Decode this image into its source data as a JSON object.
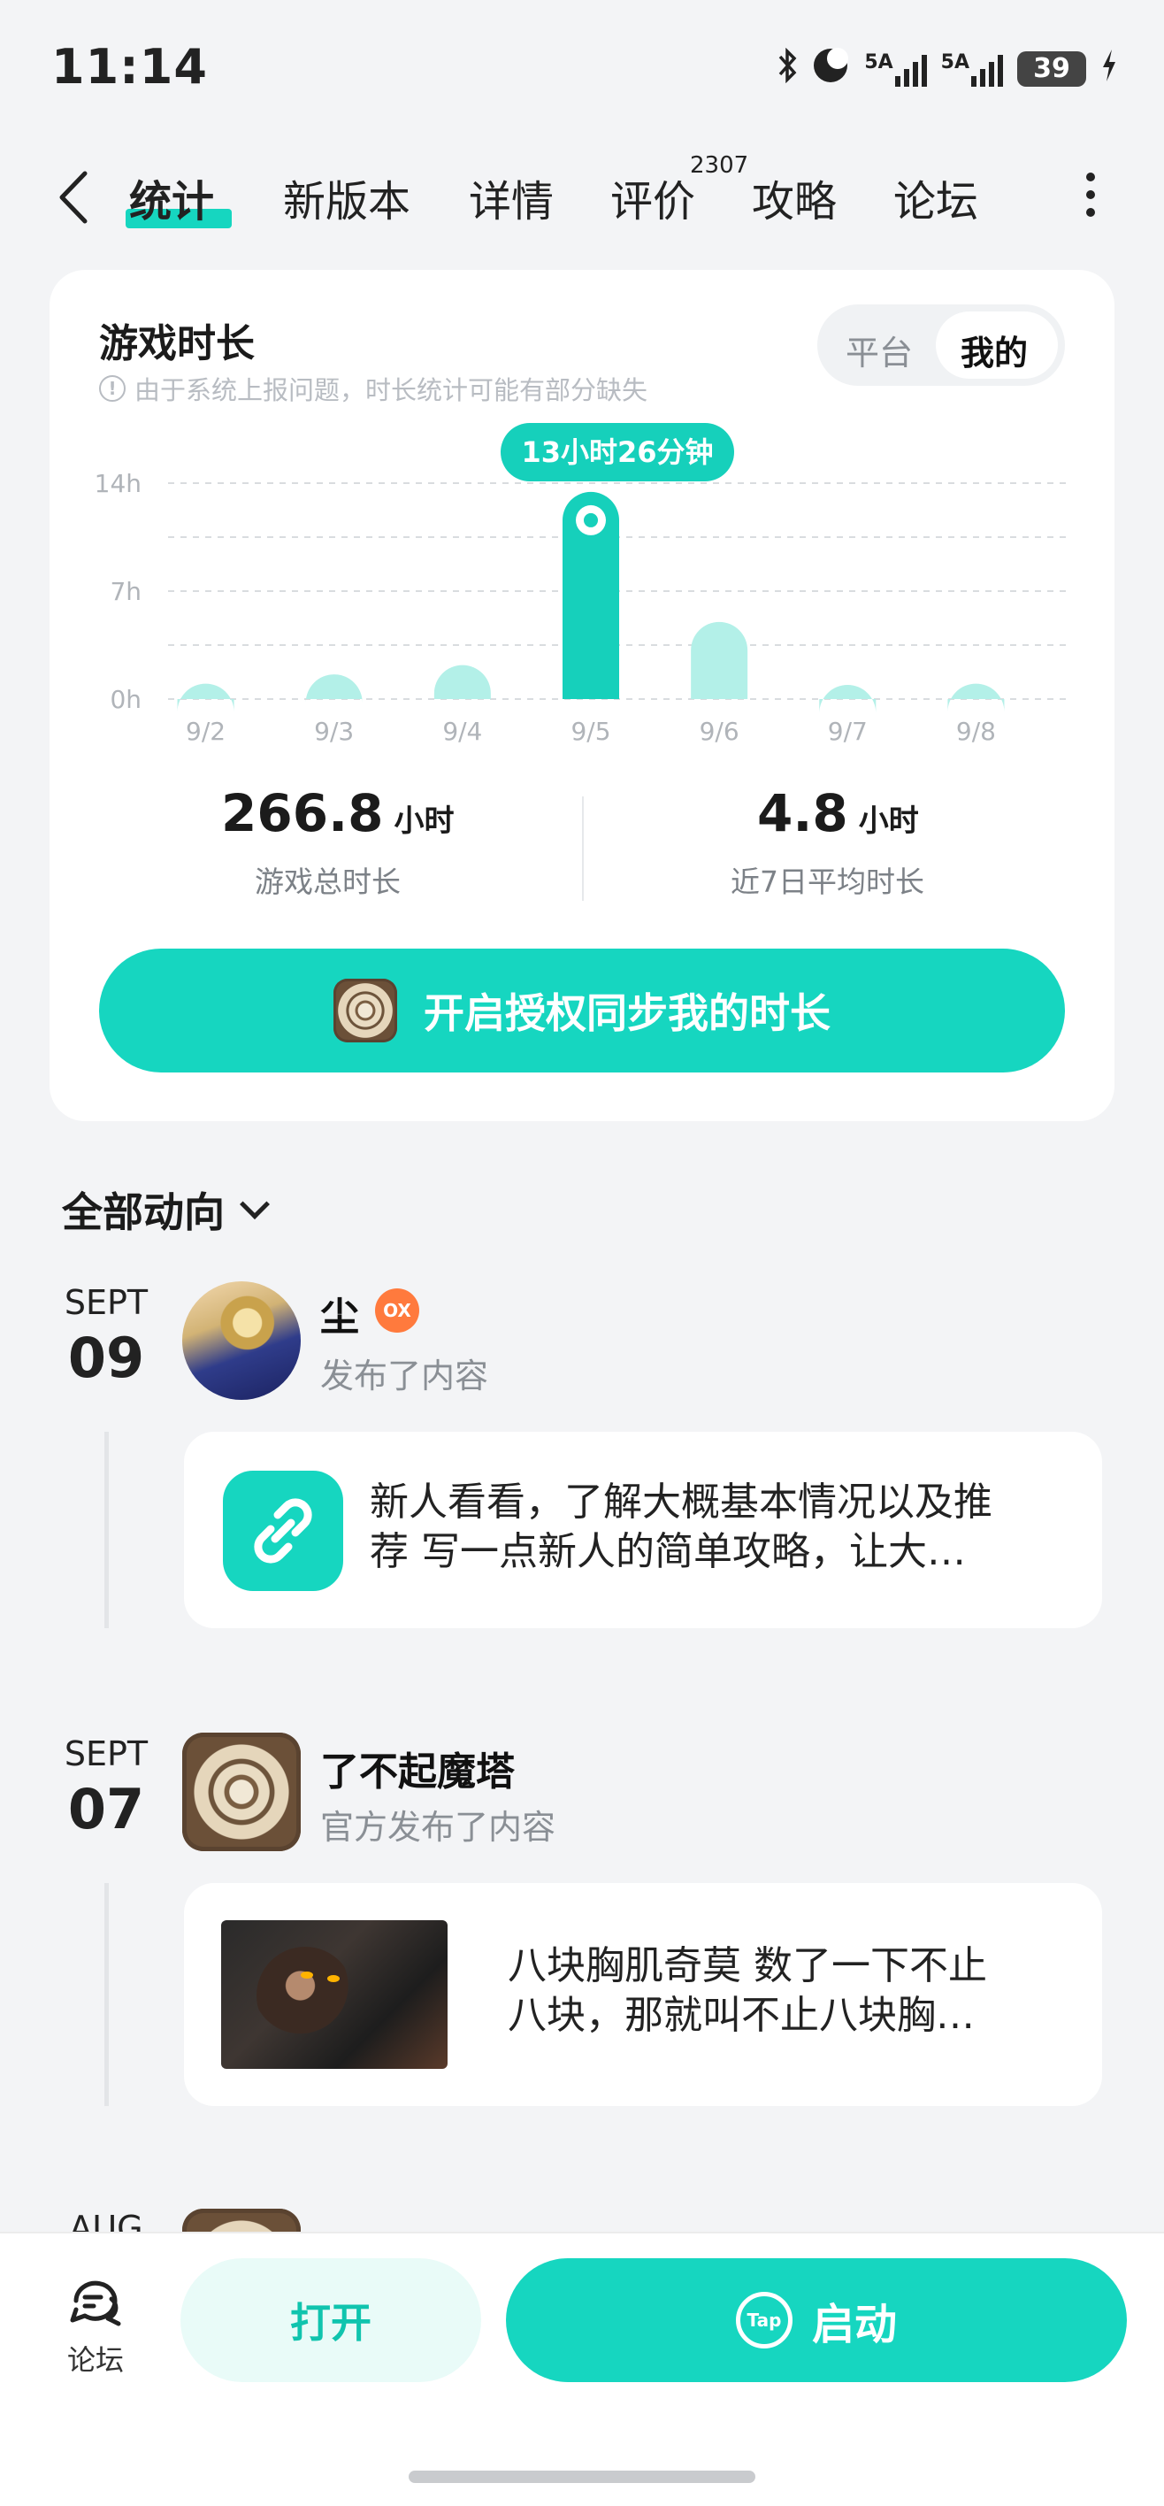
{
  "status_bar": {
    "time": "11:14",
    "net1": "5A",
    "net2": "5A",
    "battery": "39"
  },
  "tabs": [
    {
      "label": "统计",
      "active": true
    },
    {
      "label": "新版本"
    },
    {
      "label": "详情"
    },
    {
      "label": "评价",
      "badge": "2307"
    },
    {
      "label": "攻略"
    },
    {
      "label": "论坛"
    }
  ],
  "playtime": {
    "title": "游戏时长",
    "note": "由于系统上报问题，时长统计可能有部分缺失",
    "toggle": {
      "platform": "平台",
      "mine": "我的"
    },
    "tooltip": "13小时26分钟",
    "total_value": "266.8",
    "total_unit": "小时",
    "total_label": "游戏总时长",
    "avg_value": "4.8",
    "avg_unit": "小时",
    "avg_label": "近7日平均时长",
    "sync_button": "开启授权同步我的时长"
  },
  "chart_data": {
    "type": "bar",
    "categories": [
      "9/2",
      "9/3",
      "9/4",
      "9/5",
      "9/6",
      "9/7",
      "9/8"
    ],
    "values": [
      1.0,
      1.6,
      2.2,
      13.43,
      5.0,
      0.5,
      1.0
    ],
    "unit": "h",
    "ylim": [
      0,
      14
    ],
    "yticks": [
      "0h",
      "7h",
      "14h"
    ],
    "grid": true,
    "highlight_index": 3,
    "colors": {
      "highlight": "#16d0bb",
      "normal": "#b3f0e8"
    }
  },
  "feed": {
    "title": "全部动向",
    "items": [
      {
        "month": "SEPT",
        "day": "09",
        "user": "尘",
        "action": "发布了内容",
        "text_line1": "新人看看，了解大概基本情况以及推",
        "text_line2": "荐 写一点新人的简单攻略，让大…"
      },
      {
        "month": "SEPT",
        "day": "07",
        "user": "了不起魔塔",
        "action": "官方发布了内容",
        "text_line1": "八块胸肌奇莫 数了一下不止",
        "text_line2": "八块，那就叫不止八块胸…"
      }
    ],
    "partial_month": "AUG"
  },
  "bottom": {
    "forum_label": "论坛",
    "open_button": "打开",
    "launch_button": "启动",
    "tap_text": "Tap"
  }
}
